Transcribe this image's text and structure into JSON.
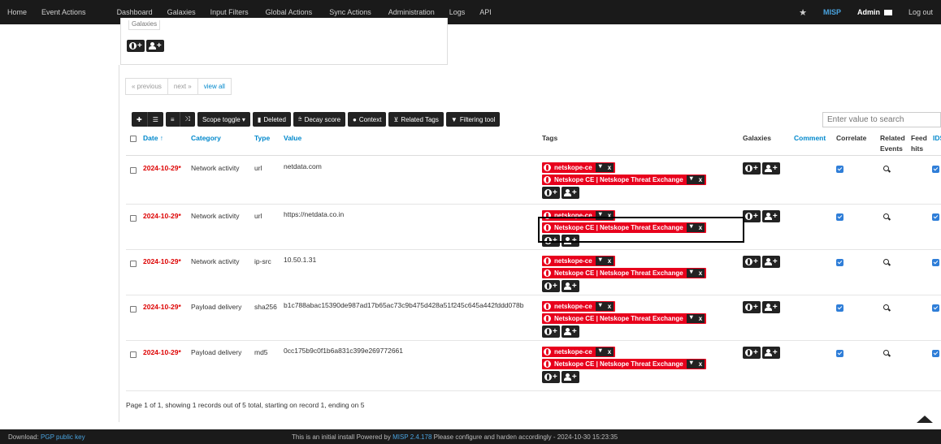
{
  "nav": {
    "left": [
      "Home",
      "Event Actions",
      "Dashboard",
      "Galaxies",
      "Input Filters",
      "Global Actions",
      "Sync Actions",
      "Administration",
      "Logs",
      "API"
    ],
    "brand": "MISP",
    "user": "Admin",
    "logout": "Log out"
  },
  "galaxy_box": {
    "label": "Galaxies"
  },
  "pager": {
    "prev": "« previous",
    "next": "next »",
    "view_all": "view all"
  },
  "toolbar": {
    "scope_toggle": "Scope toggle ▾",
    "deleted": "Deleted",
    "decay_score": "Decay score",
    "context": "Context",
    "related_tags": "Related Tags",
    "filtering_tool": "Filtering tool"
  },
  "search": {
    "placeholder": "Enter value to search"
  },
  "columns": {
    "date": "Date ↑",
    "category": "Category",
    "type": "Type",
    "value": "Value",
    "tags": "Tags",
    "galaxies": "Galaxies",
    "comment": "Comment",
    "correlate": "Correlate",
    "related_events": "Related Events",
    "feed_hits": "Feed hits",
    "ids": "IDS"
  },
  "rows": [
    {
      "date": "2024-10-29*",
      "category": "Network activity",
      "type": "url",
      "value": "netdata.com"
    },
    {
      "date": "2024-10-29*",
      "category": "Network activity",
      "type": "url",
      "value": "https://netdata.co.in"
    },
    {
      "date": "2024-10-29*",
      "category": "Network activity",
      "type": "ip-src",
      "value": "10.50.1.31"
    },
    {
      "date": "2024-10-29*",
      "category": "Payload delivery",
      "type": "sha256",
      "value": "b1c788abac15390de987ad17b65ac73c9b475d428a51f245c645a442fddd078b"
    },
    {
      "date": "2024-10-29*",
      "category": "Payload delivery",
      "type": "md5",
      "value": "0cc175b9c0f1b6a831c399e269772661"
    }
  ],
  "tags": {
    "tag1": "netskope-ce",
    "tag2": "Netskope CE | Netskope Threat Exchange",
    "remove": "x"
  },
  "footnote": "Page 1 of 1, showing 1 records out of 5 total, starting on record 1, ending on 5",
  "footer": {
    "download_label": "Download:",
    "download_link": "PGP public key",
    "center_pre": "This is an initial install Powered by",
    "center_link": "MISP 2.4.178",
    "center_post": "Please configure and harden accordingly - 2024-10-30 15:23:35"
  },
  "colors": {
    "tag_red": "#e8001c",
    "link_blue": "#0088cc",
    "date_red": "#d00"
  }
}
